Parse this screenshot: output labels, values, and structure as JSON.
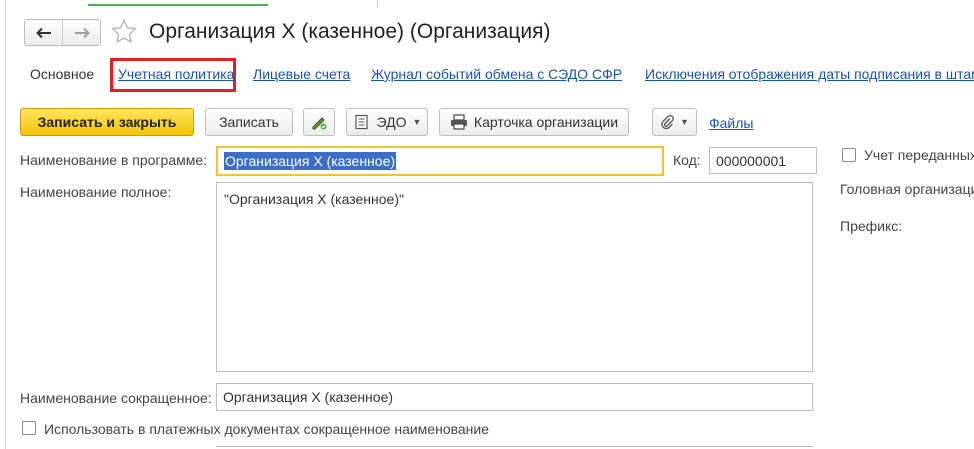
{
  "window": {
    "title": "Организация Х (казенное) (Организация)"
  },
  "nav": {
    "back_icon": "arrow-left-icon",
    "forward_icon": "arrow-right-icon",
    "favorite_icon": "star-icon"
  },
  "tabs": {
    "main": "Основное",
    "links": [
      "Учетная политика",
      "Лицевые счета",
      "Журнал событий обмена с СЭДО СФР",
      "Исключения отображения даты подписания в штам"
    ],
    "highlight_color": "#e31e24"
  },
  "toolbar": {
    "save_close_label": "Записать и закрыть",
    "save_label": "Записать",
    "edo_label": "ЭДО",
    "card_label": "Карточка организации",
    "files_label": "Файлы",
    "primary_color": "#f4c30a"
  },
  "form": {
    "name_label": "Наименование в программе:",
    "name_value": "Организация Х (казенное)",
    "code_label": "Код:",
    "code_value": "000000001",
    "account_label": "Учет переданных",
    "head_org_label": "Головная организаци",
    "prefix_label": "Префикс:",
    "full_label": "Наименование полное:",
    "full_value": "\"Организация Х (казенное)\"",
    "short_label": "Наименование сокращенное:",
    "short_value": "Организация Х (казенное)",
    "use_short_label": "Использовать в платежных документах сокращенное наименование"
  }
}
